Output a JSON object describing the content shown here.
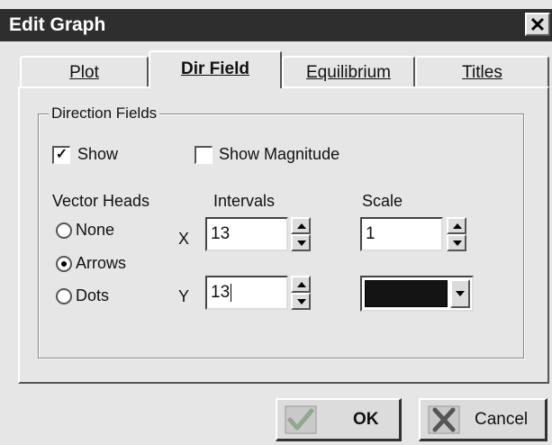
{
  "window": {
    "title": "Edit Graph",
    "close_glyph": "✕"
  },
  "tabs": [
    {
      "label": "Plot",
      "mnemonic_index": 0,
      "active": false
    },
    {
      "label": "Dir Field",
      "mnemonic_index": 0,
      "active": true
    },
    {
      "label": "Equilibrium",
      "mnemonic_index": 0,
      "active": false
    },
    {
      "label": "Titles",
      "mnemonic_index": 0,
      "active": false
    }
  ],
  "direction_fields": {
    "group_label": "Direction Fields",
    "show": {
      "label": "Show",
      "checked": true
    },
    "show_magnitude": {
      "label": "Show Magnitude",
      "checked": false
    },
    "vector_heads": {
      "label": "Vector Heads",
      "options": [
        {
          "label": "None",
          "selected": false
        },
        {
          "label": "Arrows",
          "selected": true
        },
        {
          "label": "Dots",
          "selected": false
        }
      ]
    },
    "intervals": {
      "label": "Intervals",
      "x_label": "X",
      "x_value": "13",
      "y_label": "Y",
      "y_value": "13"
    },
    "scale": {
      "label": "Scale",
      "value": "1"
    },
    "color": {
      "value": "#141414"
    }
  },
  "buttons": {
    "ok": {
      "label": "OK",
      "icon": "checkmark-icon"
    },
    "cancel": {
      "label": "Cancel",
      "icon": "x-icon"
    }
  },
  "colors": {
    "titlebar": "#2e2e2e",
    "dialog_bg": "#e6e6e6",
    "ok_check": "#8fa88f",
    "cancel_x": "#555555"
  }
}
